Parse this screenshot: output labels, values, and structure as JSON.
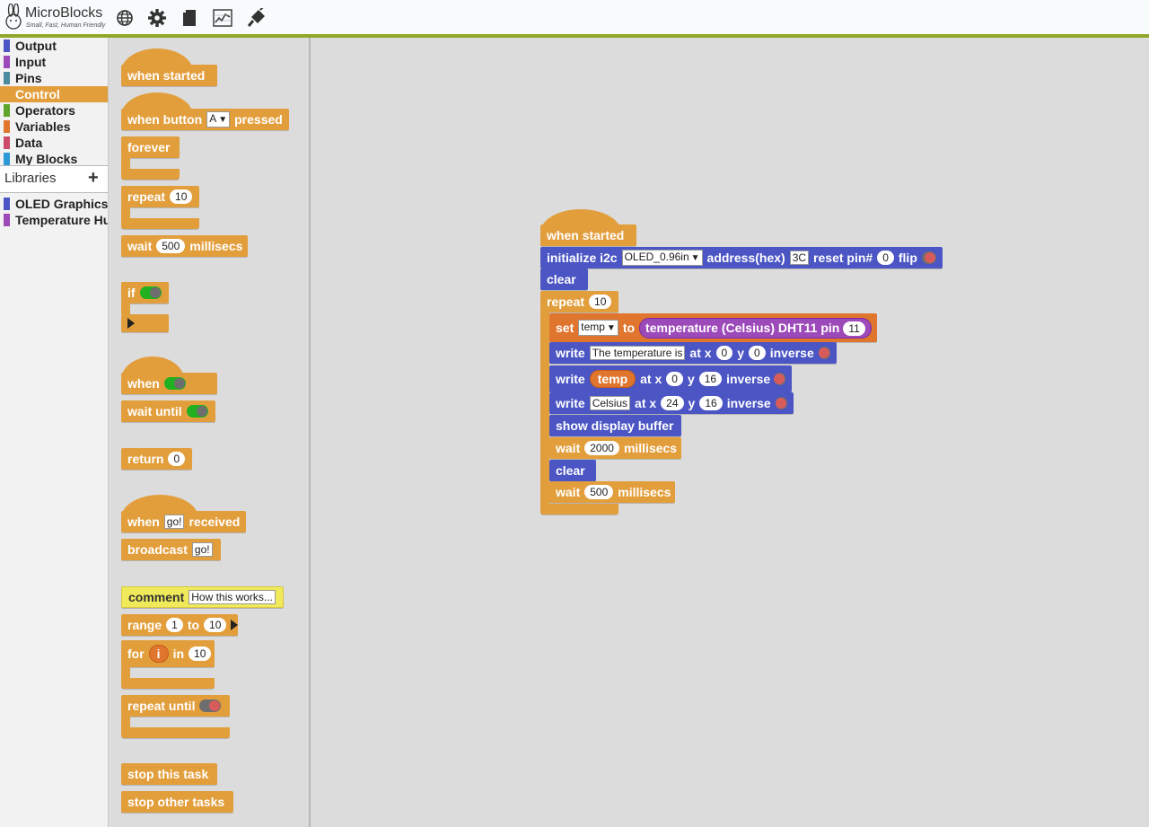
{
  "app": {
    "name": "MicroBlocks",
    "tagline": "Small, Fast, Human Friendly"
  },
  "toolbar": {
    "icons": [
      "globe-icon",
      "gear-icon",
      "file-icon",
      "graph-icon",
      "connect-icon"
    ]
  },
  "categories": [
    {
      "label": "Output",
      "color": "#4b55c3"
    },
    {
      "label": "Input",
      "color": "#9c49b9"
    },
    {
      "label": "Pins",
      "color": "#4c8aa0"
    },
    {
      "label": "Control",
      "color": "#e39e3c"
    },
    {
      "label": "Operators",
      "color": "#5fa52a"
    },
    {
      "label": "Variables",
      "color": "#e0752e"
    },
    {
      "label": "Data",
      "color": "#cc4a6a"
    },
    {
      "label": "My Blocks",
      "color": "#2c9ad8"
    }
  ],
  "libraries": {
    "header": "Libraries",
    "add": "+",
    "items": [
      {
        "label": "OLED Graphics",
        "color": "#4b55c3"
      },
      {
        "label": "Temperature Humidity",
        "color": "#9c49b9"
      }
    ]
  },
  "palette": {
    "when_started": "when started",
    "when_button": "when button",
    "button_value": "A",
    "pressed": "pressed",
    "forever": "forever",
    "repeat": "repeat",
    "repeat_count": "10",
    "wait": "wait",
    "wait_ms_value": "500",
    "millisecs": "millisecs",
    "if": "if",
    "when": "when",
    "wait_until": "wait until",
    "return": "return",
    "return_value": "0",
    "when_msg": "when",
    "msg_value": "go!",
    "received": "received",
    "broadcast": "broadcast",
    "broadcast_value": "go!",
    "comment": "comment",
    "comment_value": "How this works...",
    "range": "range",
    "range_from": "1",
    "to": "to",
    "range_to": "10",
    "for": "for",
    "for_var": "i",
    "in": "in",
    "for_in_value": "10",
    "repeat_until": "repeat until",
    "stop_this_task": "stop this task",
    "stop_other_tasks": "stop other tasks"
  },
  "script": {
    "when_started": "when started",
    "init": {
      "label": "initialize i2c",
      "device": "OLED_0.96in",
      "address_label": "address(hex)",
      "address": "3C",
      "reset_label": "reset pin#",
      "reset": "0",
      "flip_label": "flip"
    },
    "clear": "clear",
    "repeat": "repeat",
    "repeat_count": "10",
    "set": {
      "label": "set",
      "var": "temp",
      "to": "to",
      "reporter": "temperature (Celsius) DHT11 pin",
      "pin": "11"
    },
    "write1": {
      "label": "write",
      "text": "The temperature is",
      "at_x": "at x",
      "x": "0",
      "y_label": "y",
      "y": "0",
      "inverse": "inverse"
    },
    "write2": {
      "label": "write",
      "var": "temp",
      "at_x": "at x",
      "x": "0",
      "y_label": "y",
      "y": "16",
      "inverse": "inverse"
    },
    "write3": {
      "label": "write",
      "text": "Celsius",
      "at_x": "at x",
      "x": "24",
      "y_label": "y",
      "y": "16",
      "inverse": "inverse"
    },
    "show_buffer": "show display buffer",
    "wait1": {
      "label": "wait",
      "value": "2000",
      "unit": "millisecs"
    },
    "clear2": "clear",
    "wait2": {
      "label": "wait",
      "value": "500",
      "unit": "millisecs"
    }
  }
}
